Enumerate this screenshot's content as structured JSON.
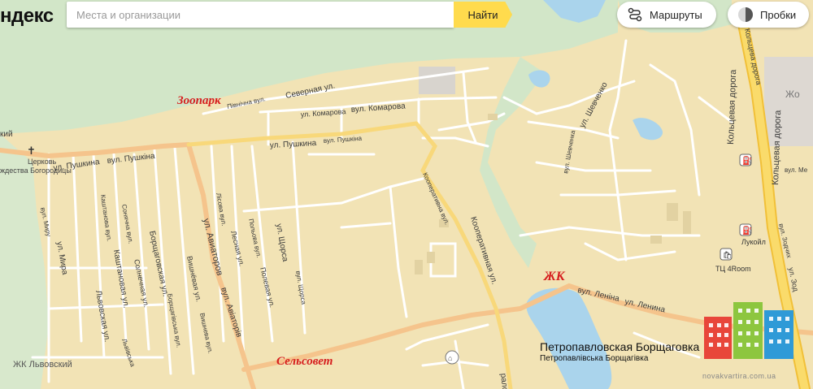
{
  "header": {
    "logo": "ндекс",
    "search_placeholder": "Места и организации",
    "search_button": "Найти",
    "routes": "Маршруты",
    "traffic": "Пробки"
  },
  "annotations": {
    "zoo": "Зоопарк",
    "zhk": "ЖК",
    "selsovet": "Сельсовет"
  },
  "labels": {
    "pivnichna": "Північна вул.",
    "severnaya": "Северная ул.",
    "komarova_ul": "ул. Комарова",
    "komarova_vul": "вул. Комарова",
    "pushkina_ul_left": "ул. Пушкина",
    "pushkina_vul_left": "вул. Пушкіна",
    "pushkina_ul_mid": "ул. Пушкина",
    "pushkina_vul_mid": "вул. Пушкіна",
    "church_name": "Церковь",
    "church_desc": "ждества Богородицы",
    "kiy": "кий",
    "kooperativnaya_vul": "Кооперативна вул.",
    "kooperativnaya_ul": "Кооперативная ул.",
    "shevchenko_ul": "ул. Шевченко",
    "shevchenko_vul": "вул. Шевченка",
    "koltsevaya1": "Кольцевая дорога",
    "koltsevaya2": "Кольцевая дорога",
    "koltsevaya_top": "Кольцева дорога",
    "lenina_vul": "вул. Леніна",
    "lenina_ul": "ул. Ленина",
    "aviatorov_ul": "ул. Авиаторов",
    "aviatoriv_vul": "вул. Авіаторів",
    "shorsa_ul": "ул. Щорса",
    "shorsa_vul": "вул. Щорса",
    "polevaya_ul": "Полевая ул.",
    "polova_vul": "Польова вул.",
    "lesnaya_ul": "Лесная ул.",
    "lisova_vul": "Лісова вул.",
    "vishneva_vul": "Вишнева вул.",
    "vishnevaya_ul": "Вишнёвая ул.",
    "borschagovskaya": "Борщаговская ул.",
    "borschagivska": "Борщагівська вул.",
    "sonyachna": "Сонячна вул.",
    "solnechnaya": "Солнечная ул.",
    "kashtanova": "Каштанова вул.",
    "kashtanovaya": "Каштановая ул.",
    "mira_vul": "вул. Миру",
    "mira_ul": "ул. Мира",
    "lvovskaya": "Львовская ул.",
    "lvivska": "Львівська",
    "zhk_lvovsky": "ЖК Львовский",
    "lukoil": "Лукойл",
    "tc": "ТЦ 4Room",
    "petro_ru": "Петропавловская Борщаговка",
    "petro_ua": "Петропавлівська Борщагівка",
    "vul_zodchikh": "вул. Зодчих",
    "ul_zodchikh": "ул. Зод",
    "vul_me": "вул. Ме",
    "zho": "Жо",
    "ralova": "ралова"
  },
  "watermark": "novakvartira.com.ua",
  "colors": {
    "land": "#f2e3b5",
    "forest": "#d2e6c8",
    "water": "#aad4ec",
    "road_major": "#f5c48c",
    "road_local": "#ffffff",
    "highway": "#f8d35e",
    "annotation": "#d61e1e"
  }
}
